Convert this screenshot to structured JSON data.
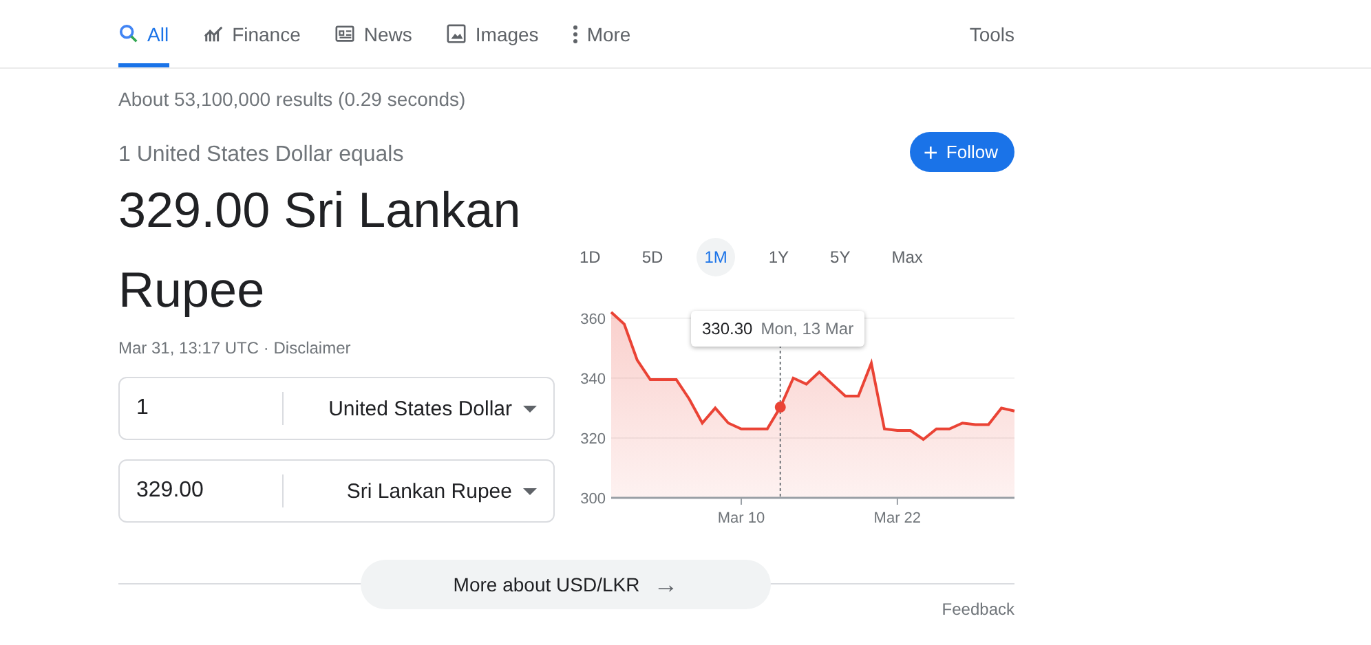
{
  "tabs": [
    {
      "label": "All",
      "kind": "search",
      "selected": true
    },
    {
      "label": "Finance",
      "kind": "finance",
      "selected": false
    },
    {
      "label": "News",
      "kind": "news",
      "selected": false
    },
    {
      "label": "Images",
      "kind": "images",
      "selected": false
    },
    {
      "label": "More",
      "kind": "more",
      "selected": false
    }
  ],
  "tools": "Tools",
  "result_stats": "About 53,100,000 results (0.29 seconds)",
  "converter": {
    "lead": "1 United States Dollar equals",
    "result_value": "329.00 Sri Lankan",
    "result_unit": "Rupee",
    "timestamp": "Mar 31, 13:17 UTC",
    "separator": "·",
    "disclaimer": "Disclaimer",
    "rows": [
      {
        "amount": "1",
        "currency": "United States Dollar"
      },
      {
        "amount": "329.00",
        "currency": "Sri Lankan Rupee"
      }
    ]
  },
  "follow_button": {
    "icon": "+",
    "label": "Follow"
  },
  "ranges": [
    {
      "label": "1D",
      "selected": false
    },
    {
      "label": "5D",
      "selected": false
    },
    {
      "label": "1M",
      "selected": true
    },
    {
      "label": "1Y",
      "selected": false
    },
    {
      "label": "5Y",
      "selected": false
    },
    {
      "label": "Max",
      "selected": false
    }
  ],
  "tooltip": {
    "value": "330.30",
    "date": "Mon, 13 Mar"
  },
  "chart_data": {
    "type": "area",
    "categories": [
      null,
      null,
      null,
      null,
      null,
      null,
      null,
      null,
      null,
      null,
      "Mar 10",
      null,
      null,
      null,
      null,
      null,
      null,
      null,
      null,
      null,
      null,
      null,
      "Mar 22",
      null,
      null,
      null,
      null,
      null,
      null,
      null,
      null,
      null
    ],
    "series": [
      {
        "color": "#ea4335",
        "values": [
          362,
          358,
          346,
          339.5,
          339.5,
          339.5,
          333,
          325,
          330,
          325,
          323,
          323,
          323,
          330.3,
          340,
          338,
          342,
          338,
          334,
          334,
          345,
          323,
          322.5,
          322.5,
          319.5,
          323,
          323,
          325,
          324.5,
          324.5,
          330,
          329
        ]
      }
    ],
    "ylim": [
      300,
      362
    ],
    "grid": true,
    "yticks": [
      300,
      320,
      340,
      360
    ]
  },
  "more_button": {
    "label": "More about USD/LKR",
    "icon": "→"
  },
  "feedback": "Feedback"
}
